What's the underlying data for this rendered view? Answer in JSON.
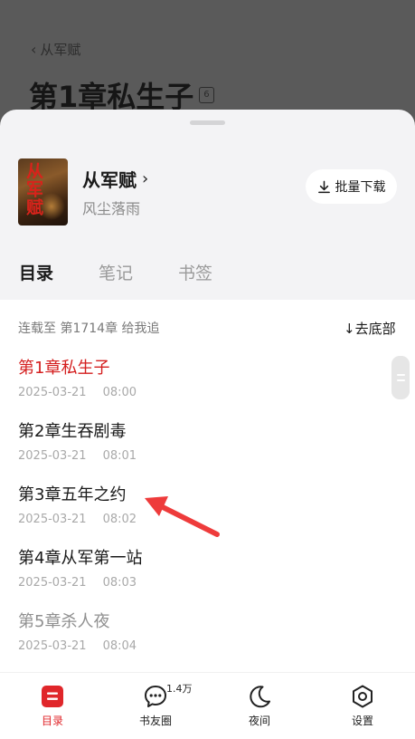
{
  "background": {
    "back_label": "从军赋",
    "chapter_title": "第1章私生子",
    "page_badge": "6"
  },
  "book": {
    "title": "从军赋",
    "author": "风尘落雨",
    "cover_text": "从军赋",
    "batch_download_label": "批量下载"
  },
  "tabs": [
    {
      "label": "目录",
      "active": true
    },
    {
      "label": "笔记",
      "active": false
    },
    {
      "label": "书签",
      "active": false
    }
  ],
  "catalog": {
    "status_text": "连载至 第1714章 给我追",
    "goto_bottom_label": "↓去底部",
    "chapters": [
      {
        "title": "第1章私生子",
        "date": "2025-03-21",
        "time": "08:00",
        "state": "current"
      },
      {
        "title": "第2章生吞剧毒",
        "date": "2025-03-21",
        "time": "08:01",
        "state": "unread"
      },
      {
        "title": "第3章五年之约",
        "date": "2025-03-21",
        "time": "08:02",
        "state": "unread"
      },
      {
        "title": "第4章从军第一站",
        "date": "2025-03-21",
        "time": "08:03",
        "state": "unread"
      },
      {
        "title": "第5章杀人夜",
        "date": "2025-03-21",
        "time": "08:04",
        "state": "read"
      }
    ]
  },
  "bottom_nav": [
    {
      "label": "目录",
      "icon": "catalog-icon",
      "active": true
    },
    {
      "label": "书友圈",
      "icon": "chat-icon",
      "badge": "1.4万",
      "active": false
    },
    {
      "label": "夜间",
      "icon": "moon-icon",
      "active": false
    },
    {
      "label": "设置",
      "icon": "settings-icon",
      "active": false
    }
  ],
  "colors": {
    "accent": "#e0262a",
    "current_chapter": "#d41f1f",
    "annotation_arrow": "#ee3b3b"
  }
}
